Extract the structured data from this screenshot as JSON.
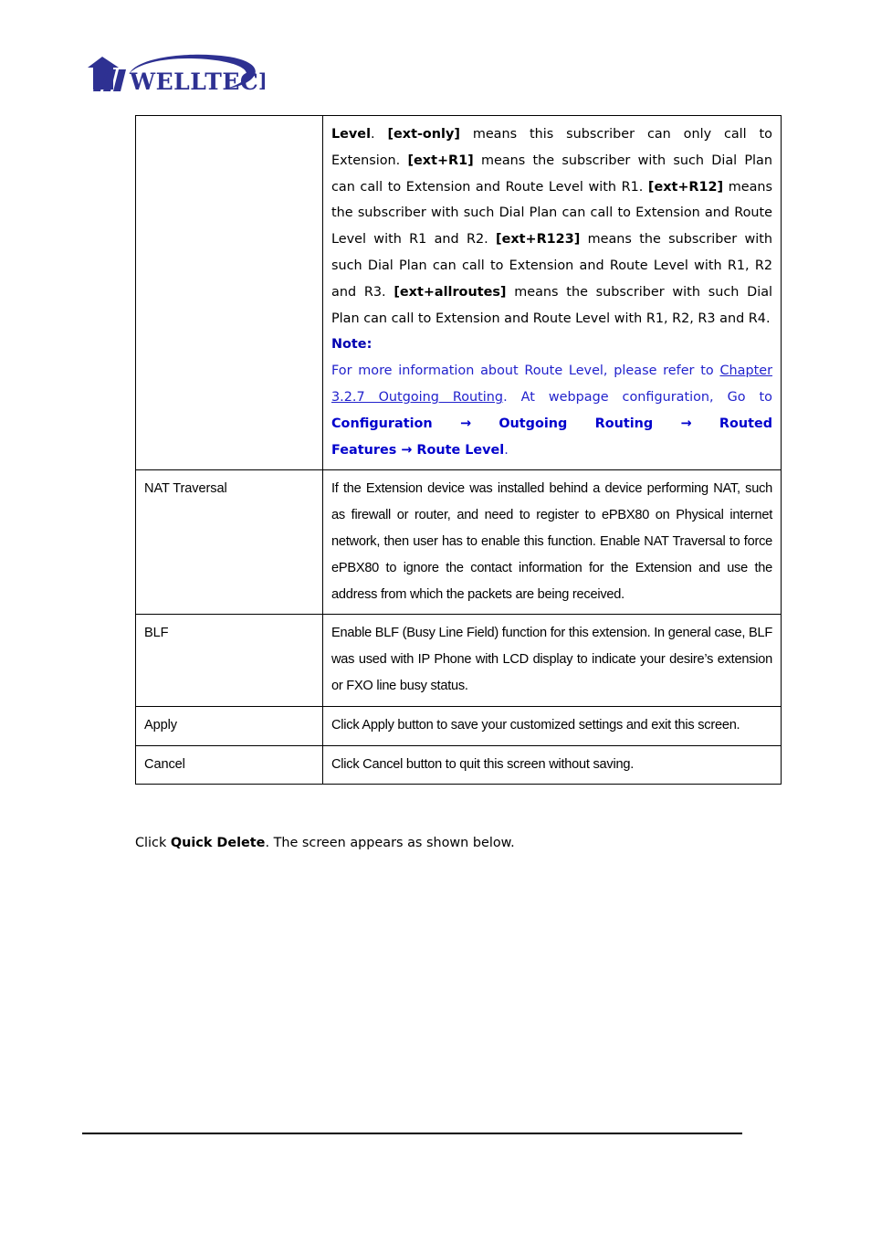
{
  "header": {
    "logo_name": "welltech-logo",
    "logo_text": "WELLTECH",
    "logo_color": "#2e3192"
  },
  "table": {
    "rows": [
      {
        "term": "",
        "paragraphs": [
          {
            "type": "rich",
            "segments": [
              {
                "text": "Level",
                "bold": true
              },
              {
                "text": ". ",
                "bold": false
              },
              {
                "text": "[ext-only]",
                "bold": true
              },
              {
                "text": " means this subscriber can only call to Extension. ",
                "bold": false
              },
              {
                "text": "[ext+R1]",
                "bold": true
              },
              {
                "text": " means the subscriber with such Dial Plan can call to Extension and Route Level with R1. ",
                "bold": false
              },
              {
                "text": "[ext+R12]",
                "bold": true
              },
              {
                "text": " means the subscriber with such Dial Plan can call to Extension and Route Level with R1 and R2. ",
                "bold": false
              },
              {
                "text": "[ext+R123]",
                "bold": true
              },
              {
                "text": " means the subscriber with such Dial Plan can call to Extension and Route Level with R1, R2 and R3. ",
                "bold": false
              },
              {
                "text": "[ext+allroutes]",
                "bold": true
              },
              {
                "text": " means the subscriber with such Dial Plan can call to Extension and Route Level with R1, R2, R3 and R4.",
                "bold": false
              }
            ]
          }
        ],
        "note": {
          "title": "Note:",
          "line_1_prefix": "For more information about Route Level, please refer to ",
          "link_text": "Chapter 3.2.7  Outgoing Routing",
          "line_1_suffix": ". At webpage configuration, Go to ",
          "path_1": "Configuration",
          "arrow": "→",
          "path_2": "Outgoing Routing",
          "path_3": "Routed Features",
          "path_4": "Route Level",
          "trailing": ".",
          "color": "#0000b0",
          "link_color": "#2222cc"
        }
      },
      {
        "term": "NAT Traversal",
        "description": "If the Extension device was installed behind a device performing NAT, such as firewall or router, and need to register to ePBX80 on Physical internet network, then user has to enable this function. Enable NAT Traversal to force ePBX80 to ignore the contact information for the Extension and use the address from which the packets are being received."
      },
      {
        "term": "BLF",
        "description": "Enable BLF (Busy Line Field) function for this extension. In general case, BLF was used with IP Phone with LCD display to indicate your desire’s extension or FXO line busy status."
      },
      {
        "term": "Apply",
        "description": "Click Apply button to save your customized settings and exit this screen."
      },
      {
        "term": "Cancel",
        "description": "Click Cancel button to quit this screen without saving."
      }
    ]
  },
  "below_paragraph": {
    "prefix": "Click ",
    "bold_term": "Quick Delete",
    "suffix": ". The screen appears as shown below."
  }
}
